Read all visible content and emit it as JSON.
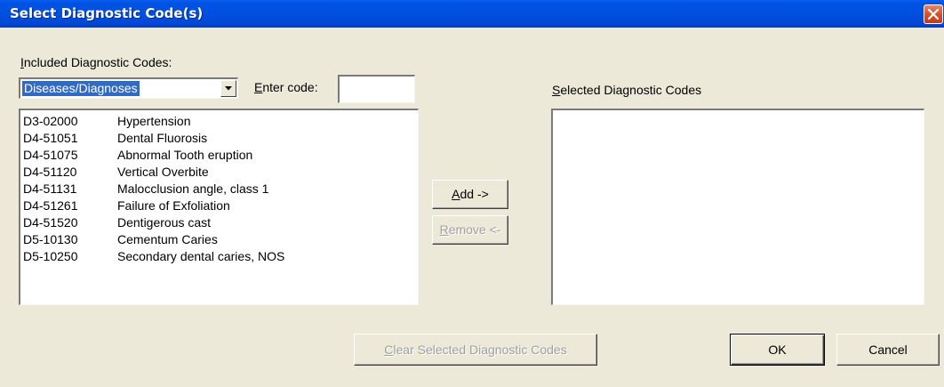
{
  "window": {
    "title": "Select Diagnostic Code(s)"
  },
  "left_panel": {
    "heading_prefix": "",
    "heading_accel": "I",
    "heading_rest": "ncluded Diagnostic Codes:",
    "category_select": {
      "value": "Diseases/Diagnoses"
    },
    "enter_code": {
      "label_accel": "E",
      "label_rest": "nter code:",
      "value": ""
    },
    "codes": [
      {
        "code": "D3-02000",
        "description": "Hypertension"
      },
      {
        "code": "D4-51051",
        "description": "Dental Fluorosis"
      },
      {
        "code": "D4-51075",
        "description": "Abnormal Tooth eruption"
      },
      {
        "code": "D4-51120",
        "description": "Vertical Overbite"
      },
      {
        "code": "D4-51131",
        "description": "Malocclusion angle, class 1"
      },
      {
        "code": "D4-51261",
        "description": "Failure of Exfoliation"
      },
      {
        "code": "D4-51520",
        "description": "Dentigerous cast"
      },
      {
        "code": "D5-10130",
        "description": "Cementum Caries"
      },
      {
        "code": "D5-10250",
        "description": "Secondary dental caries, NOS"
      }
    ]
  },
  "middle": {
    "add": {
      "accel": "A",
      "rest": "dd ->"
    },
    "remove": {
      "accel": "R",
      "rest": "emove <-"
    }
  },
  "right_panel": {
    "heading_accel": "S",
    "heading_rest": "elected Diagnostic Codes",
    "items": []
  },
  "footer": {
    "clear": {
      "accel": "C",
      "rest": "lear Selected Diagnostic Codes"
    },
    "ok": "OK",
    "cancel": "Cancel"
  },
  "colors": {
    "titlebar": "#0050e0",
    "face": "#ece9d8",
    "selection": "#316ac5",
    "close": "#d6522f"
  }
}
